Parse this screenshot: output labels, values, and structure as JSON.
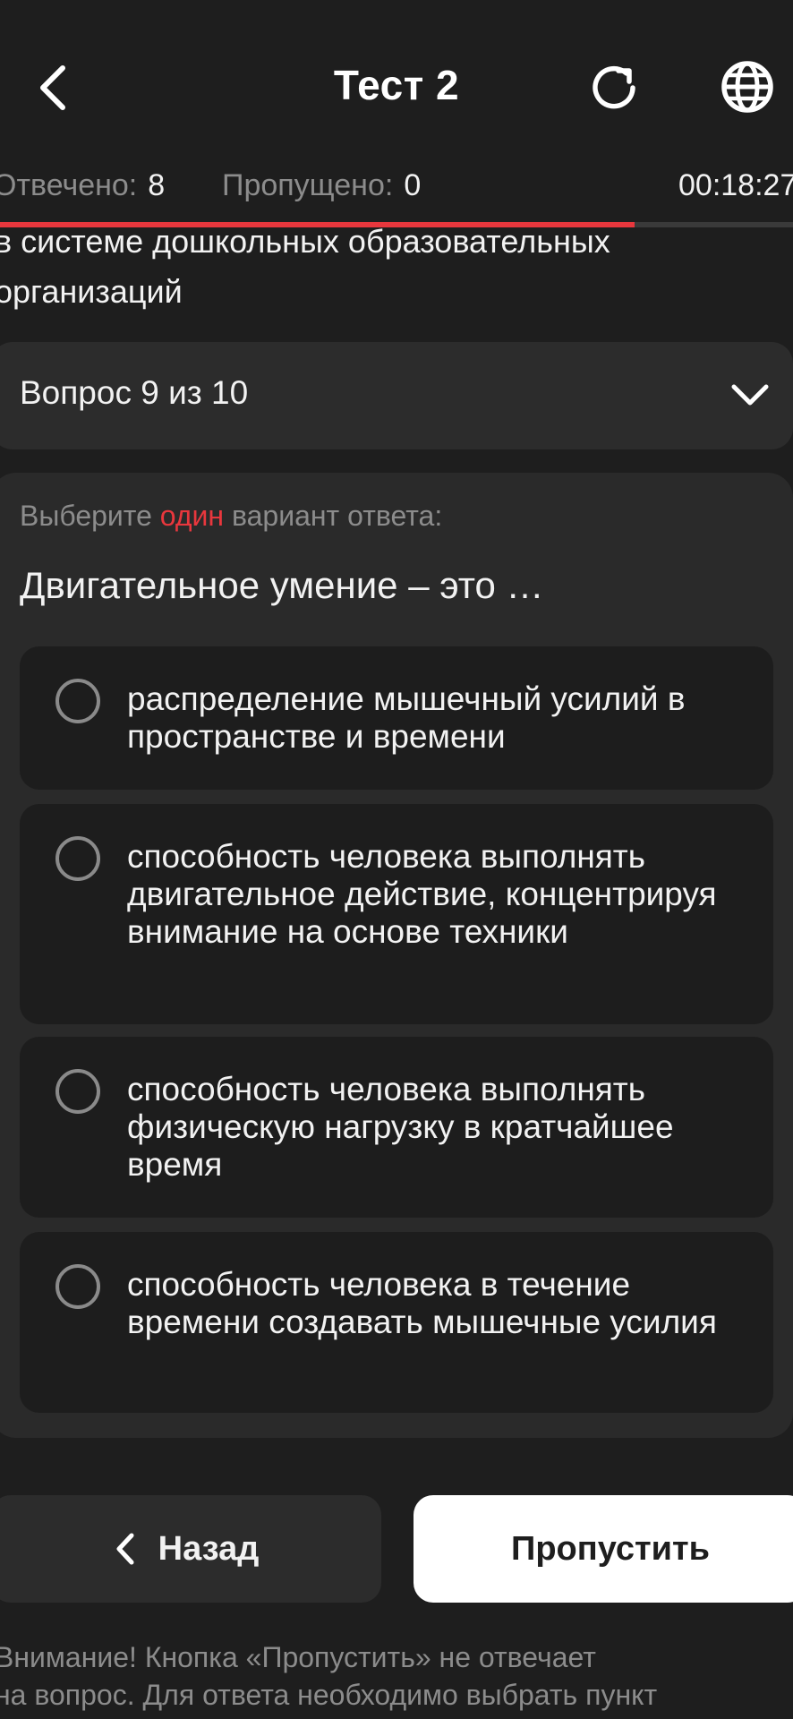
{
  "header": {
    "title": "Тест 2",
    "back_icon": "chevron-left-icon",
    "reload_icon": "reload-icon",
    "language_icon": "globe-icon"
  },
  "stats": {
    "answered_label": "Отвечено:",
    "answered_value": "8",
    "skipped_label": "Пропущено:",
    "skipped_value": "0",
    "timer": "00:18:27"
  },
  "progress": {
    "fraction": 0.8,
    "fill_color": "#e8373d"
  },
  "topic": {
    "line1": "в системе дошкольных образовательных",
    "line2": "организаций"
  },
  "question_selector": {
    "label": "Вопрос 9 из 10",
    "icon": "chevron-down-icon"
  },
  "question": {
    "instruction_before": "Выберите",
    "instruction_accent": "один",
    "instruction_after": "вариант ответа:",
    "text": "Двигательное умение – это …",
    "options": [
      {
        "text": "распределение мышечный усилий в пространстве и времени",
        "selected": false
      },
      {
        "text": "способность человека выполнять двигательное действие, концентрируя внимание на основе техники",
        "selected": false
      },
      {
        "text": "способность человека выполнять физическую нагрузку в кратчайшее время",
        "selected": false
      },
      {
        "text": "способность человека в течение времени создавать мышечные усилия",
        "selected": false
      }
    ]
  },
  "buttons": {
    "back_label": "Назад",
    "skip_label": "Пропустить"
  },
  "notice": {
    "line1": "Внимание! Кнопка «Пропустить» не отвечает",
    "line2": "на вопрос. Для ответа необходимо выбрать пункт"
  },
  "colors": {
    "background": "#1e1e1e",
    "accent": "#e8373d",
    "card": "#2a2a2a",
    "option": "#1d1d1d"
  }
}
